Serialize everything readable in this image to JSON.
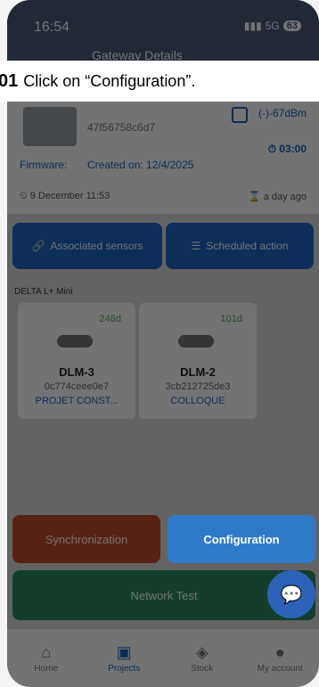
{
  "status": {
    "time": "16:54",
    "signal": "5G",
    "battery": "63"
  },
  "header": {
    "title": "Gateway Details"
  },
  "device": {
    "id": "47f56758c6d7",
    "rssi": "(-)-67dBm",
    "timer": "03:00",
    "firmware_label": "Firmware:",
    "created": "Created on: 12/4/2025",
    "date": "9 December 11:53",
    "ago": "a day ago"
  },
  "actions": {
    "associated": "Associated sensors",
    "scheduled": "Scheduled action"
  },
  "devices_label": "DELTA L+ Mini",
  "tiles": [
    {
      "age": "246d",
      "name": "DLM-3",
      "mac": "0c774ceee0e7",
      "project": "PROJET CONST..."
    },
    {
      "age": "101d",
      "name": "DLM-2",
      "mac": "3cb212725de3",
      "project": "COLLOQUE"
    }
  ],
  "bottom": {
    "sync": "Synchronization",
    "config": "Configuration",
    "network": "Network Test"
  },
  "tabs": [
    "Home",
    "Projects",
    "Stock",
    "My account"
  ],
  "instruction": {
    "number": "01",
    "text": "Click on “Configuration”."
  }
}
